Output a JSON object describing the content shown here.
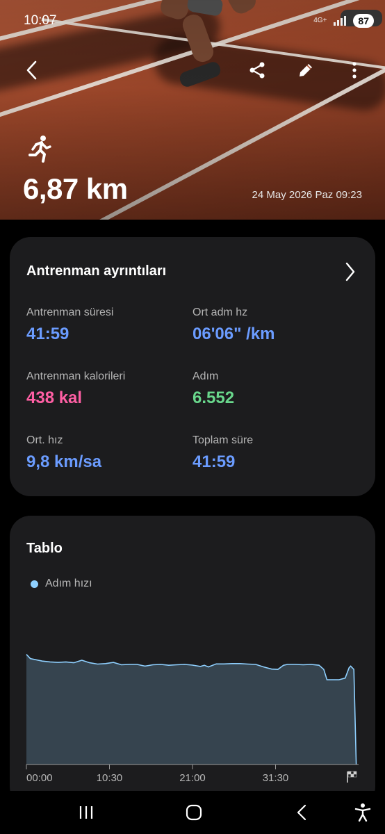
{
  "status_bar": {
    "time": "10:07",
    "network": "4G+",
    "battery": "87"
  },
  "header": {
    "icons": [
      "back-icon",
      "share-icon",
      "edit-icon",
      "more-icon"
    ],
    "activity_icon": "running-person-icon",
    "distance": "6,87 km",
    "date_time": "24 May 2026 Paz 09:23"
  },
  "workout_details": {
    "title": "Antrenman ayrıntıları",
    "stats": [
      {
        "label": "Antrenman süresi",
        "value": "41:59",
        "color": "#6b9cff"
      },
      {
        "label": "Ort adm hz",
        "value": "06'06\" /km",
        "color": "#6b9cff"
      },
      {
        "label": "Antrenman kalorileri",
        "value": "438 kal",
        "color": "#ff5fa4"
      },
      {
        "label": "Adım",
        "value": "6.552",
        "color": "#69d78c"
      },
      {
        "label": "Ort. hız",
        "value": "9,8 km/sa",
        "color": "#6b9cff"
      },
      {
        "label": "Toplam süre",
        "value": "41:59",
        "color": "#6b9cff"
      }
    ]
  },
  "chart_section": {
    "title": "Tablo",
    "legend": "Adım hızı"
  },
  "chart_data": {
    "type": "area",
    "series": [
      {
        "name": "Adım hızı",
        "color": "#8fd0ff",
        "points": [
          [
            0,
            0.66
          ],
          [
            0.5,
            0.635
          ],
          [
            1,
            0.63
          ],
          [
            2,
            0.62
          ],
          [
            3,
            0.615
          ],
          [
            4,
            0.612
          ],
          [
            5,
            0.615
          ],
          [
            6,
            0.61
          ],
          [
            7,
            0.625
          ],
          [
            8,
            0.61
          ],
          [
            9,
            0.602
          ],
          [
            10,
            0.605
          ],
          [
            11,
            0.612
          ],
          [
            12,
            0.598
          ],
          [
            13,
            0.6
          ],
          [
            14,
            0.6
          ],
          [
            15,
            0.59
          ],
          [
            16,
            0.598
          ],
          [
            17,
            0.6
          ],
          [
            18,
            0.595
          ],
          [
            19,
            0.598
          ],
          [
            20,
            0.6
          ],
          [
            21,
            0.596
          ],
          [
            22,
            0.588
          ],
          [
            22.5,
            0.595
          ],
          [
            23,
            0.585
          ],
          [
            24,
            0.603
          ],
          [
            25,
            0.603
          ],
          [
            26,
            0.605
          ],
          [
            27,
            0.605
          ],
          [
            28,
            0.602
          ],
          [
            29,
            0.6
          ],
          [
            30,
            0.585
          ],
          [
            31,
            0.572
          ],
          [
            31.8,
            0.57
          ],
          [
            32.5,
            0.595
          ],
          [
            33,
            0.6
          ],
          [
            34,
            0.6
          ],
          [
            35,
            0.598
          ],
          [
            36,
            0.6
          ],
          [
            37,
            0.595
          ],
          [
            37.6,
            0.57
          ],
          [
            38,
            0.508
          ],
          [
            39.5,
            0.508
          ],
          [
            40.3,
            0.518
          ],
          [
            40.8,
            0.58
          ],
          [
            41,
            0.59
          ],
          [
            41.4,
            0.57
          ],
          [
            41.7,
            0.0
          ]
        ]
      }
    ],
    "x_ticks": [
      "00:00",
      "10:30",
      "21:00",
      "31:30"
    ],
    "x_tick_values": [
      0,
      10.5,
      21,
      31.5
    ],
    "xlim": [
      0,
      42
    ],
    "end_icon": "finish-flag-icon"
  },
  "navigation": {
    "icons": [
      "recent-apps-icon",
      "home-icon",
      "back-nav-icon",
      "accessibility-icon"
    ]
  }
}
